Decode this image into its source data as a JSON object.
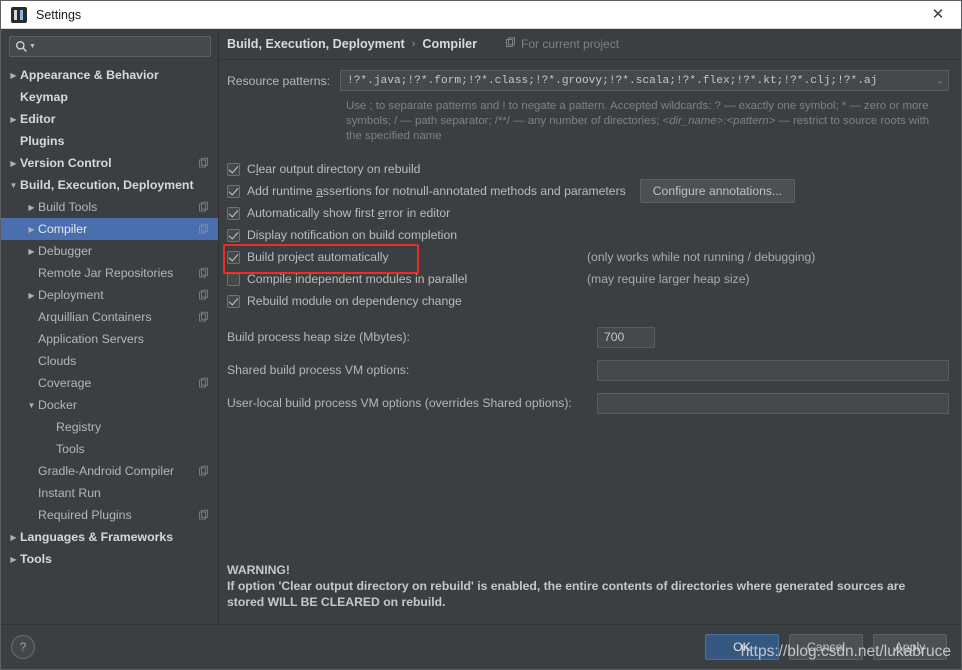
{
  "window": {
    "title": "Settings",
    "close_label": "✕",
    "app_icon": "intellij-idea-icon"
  },
  "sidebar": {
    "search": {
      "value": "",
      "placeholder": ""
    },
    "items": [
      {
        "label": "Appearance & Behavior",
        "indent": 0,
        "arrow": "▶",
        "top": true,
        "badge": false
      },
      {
        "label": "Keymap",
        "indent": 0,
        "arrow": "",
        "top": true,
        "badge": false
      },
      {
        "label": "Editor",
        "indent": 0,
        "arrow": "▶",
        "top": true,
        "badge": false
      },
      {
        "label": "Plugins",
        "indent": 0,
        "arrow": "",
        "top": true,
        "badge": false
      },
      {
        "label": "Version Control",
        "indent": 0,
        "arrow": "▶",
        "top": true,
        "badge": true
      },
      {
        "label": "Build, Execution, Deployment",
        "indent": 0,
        "arrow": "▼",
        "top": true,
        "badge": false
      },
      {
        "label": "Build Tools",
        "indent": 1,
        "arrow": "▶",
        "top": false,
        "badge": true
      },
      {
        "label": "Compiler",
        "indent": 1,
        "arrow": "▶",
        "top": false,
        "badge": true,
        "selected": true
      },
      {
        "label": "Debugger",
        "indent": 1,
        "arrow": "▶",
        "top": false,
        "badge": false
      },
      {
        "label": "Remote Jar Repositories",
        "indent": 1,
        "arrow": "",
        "top": false,
        "badge": true
      },
      {
        "label": "Deployment",
        "indent": 1,
        "arrow": "▶",
        "top": false,
        "badge": true
      },
      {
        "label": "Arquillian Containers",
        "indent": 1,
        "arrow": "",
        "top": false,
        "badge": true
      },
      {
        "label": "Application Servers",
        "indent": 1,
        "arrow": "",
        "top": false,
        "badge": false
      },
      {
        "label": "Clouds",
        "indent": 1,
        "arrow": "",
        "top": false,
        "badge": false
      },
      {
        "label": "Coverage",
        "indent": 1,
        "arrow": "",
        "top": false,
        "badge": true
      },
      {
        "label": "Docker",
        "indent": 1,
        "arrow": "▼",
        "top": false,
        "badge": false
      },
      {
        "label": "Registry",
        "indent": 2,
        "arrow": "",
        "top": false,
        "badge": false
      },
      {
        "label": "Tools",
        "indent": 2,
        "arrow": "",
        "top": false,
        "badge": false
      },
      {
        "label": "Gradle-Android Compiler",
        "indent": 1,
        "arrow": "",
        "top": false,
        "badge": true
      },
      {
        "label": "Instant Run",
        "indent": 1,
        "arrow": "",
        "top": false,
        "badge": false
      },
      {
        "label": "Required Plugins",
        "indent": 1,
        "arrow": "",
        "top": false,
        "badge": true
      },
      {
        "label": "Languages & Frameworks",
        "indent": 0,
        "arrow": "▶",
        "top": true,
        "badge": false
      },
      {
        "label": "Tools",
        "indent": 0,
        "arrow": "▶",
        "top": true,
        "badge": false
      }
    ]
  },
  "breadcrumb": {
    "parent": "Build, Execution, Deployment",
    "separator": "›",
    "current": "Compiler",
    "scope_note": "For current project"
  },
  "compiler": {
    "resource_patterns_label": "Resource patterns:",
    "resource_patterns_value": "!?*.java;!?*.form;!?*.class;!?*.groovy;!?*.scala;!?*.flex;!?*.kt;!?*.clj;!?*.aj",
    "resource_patterns_expand": "⌄",
    "hint_part1": "Use ; to separate patterns and ! to negate a pattern. Accepted wildcards: ? — exactly one symbol; * — zero or more symbols; / — path separator; /**/ — any number of directories; ",
    "hint_italic": "<dir_name>:<pattern>",
    "hint_part2": " — restrict to source roots with the specified name",
    "checkboxes": [
      {
        "label_before": "C",
        "mnemonic": "l",
        "label_after": "ear output directory on rebuild",
        "checked": true,
        "note": ""
      },
      {
        "label_before": "Add runtime ",
        "mnemonic": "a",
        "label_after": "ssertions for notnull-annotated methods and parameters",
        "checked": true,
        "note": ""
      },
      {
        "label_before": "Automatically show first ",
        "mnemonic": "e",
        "label_after": "rror in editor",
        "checked": true,
        "note": ""
      },
      {
        "label_before": "Display notification on build completion",
        "mnemonic": "",
        "label_after": "",
        "checked": true,
        "note": ""
      },
      {
        "label_before": "Build project automatically",
        "mnemonic": "",
        "label_after": "",
        "checked": true,
        "note": "(only works while not running / debugging)",
        "highlighted": true
      },
      {
        "label_before": "Compile independent modules in parallel",
        "mnemonic": "",
        "label_after": "",
        "checked": false,
        "note": "(may require larger heap size)"
      },
      {
        "label_before": "Rebuild module on dependency change",
        "mnemonic": "",
        "label_after": "",
        "checked": true,
        "note": ""
      }
    ],
    "configure_annotations_label": "Configure annotations...",
    "params": [
      {
        "label": "Build process heap size (Mbytes):",
        "value": "700",
        "kind": "heap"
      },
      {
        "label": "Shared build process VM options:",
        "value": "",
        "kind": "vm"
      },
      {
        "label": "User-local build process VM options (overrides Shared options):",
        "value": "",
        "kind": "vm"
      }
    ],
    "warning_title": "WARNING!",
    "warning_body": "If option 'Clear output directory on rebuild' is enabled, the entire contents of directories where generated sources are stored WILL BE CLEARED on rebuild."
  },
  "footer": {
    "help_label": "?",
    "ok_label": "OK",
    "cancel_label": "Cancel",
    "apply_label": "Apply",
    "watermark": "https://blog.csdn.net/lukabruce"
  },
  "colors": {
    "selection_blue": "#4b6eaf",
    "primary_button": "#365880",
    "highlight_red": "#ef2b26",
    "panel_bg": "#3c3f41",
    "input_bg": "#45494a"
  }
}
